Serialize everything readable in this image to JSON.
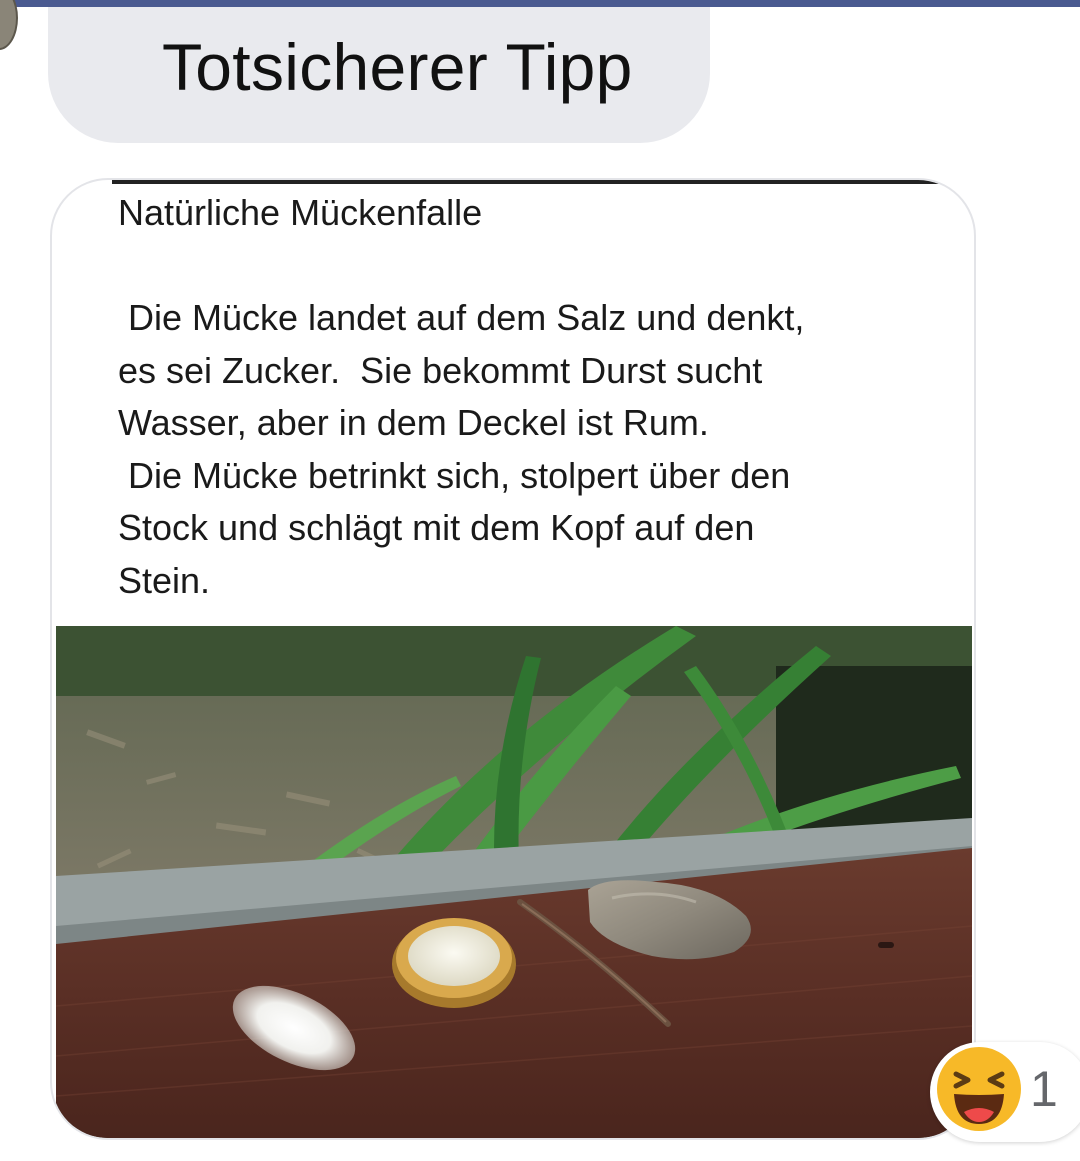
{
  "message": {
    "bubble_text": "Totsicherer Tipp"
  },
  "shared_post": {
    "title": "Natürliche Mückenfalle",
    "body_lines": [
      " Die Mücke landet auf dem Salz und denkt,",
      "es sei Zucker.  Sie bekommt Durst sucht",
      "Wasser, aber in dem Deckel ist Rum.",
      " Die Mücke betrinkt sich, stolpert über den",
      "Stock und schlägt mit dem Kopf auf den",
      "Stein."
    ],
    "photo_objects": [
      "salt-pile",
      "bottle-cap",
      "stick",
      "stone"
    ]
  },
  "reaction": {
    "emoji": "laughing-face-icon",
    "count": "1"
  },
  "colors": {
    "topbar": "#4a5a90",
    "bubble_bg": "#e9eaee",
    "reaction_yellow": "#f7b928"
  }
}
